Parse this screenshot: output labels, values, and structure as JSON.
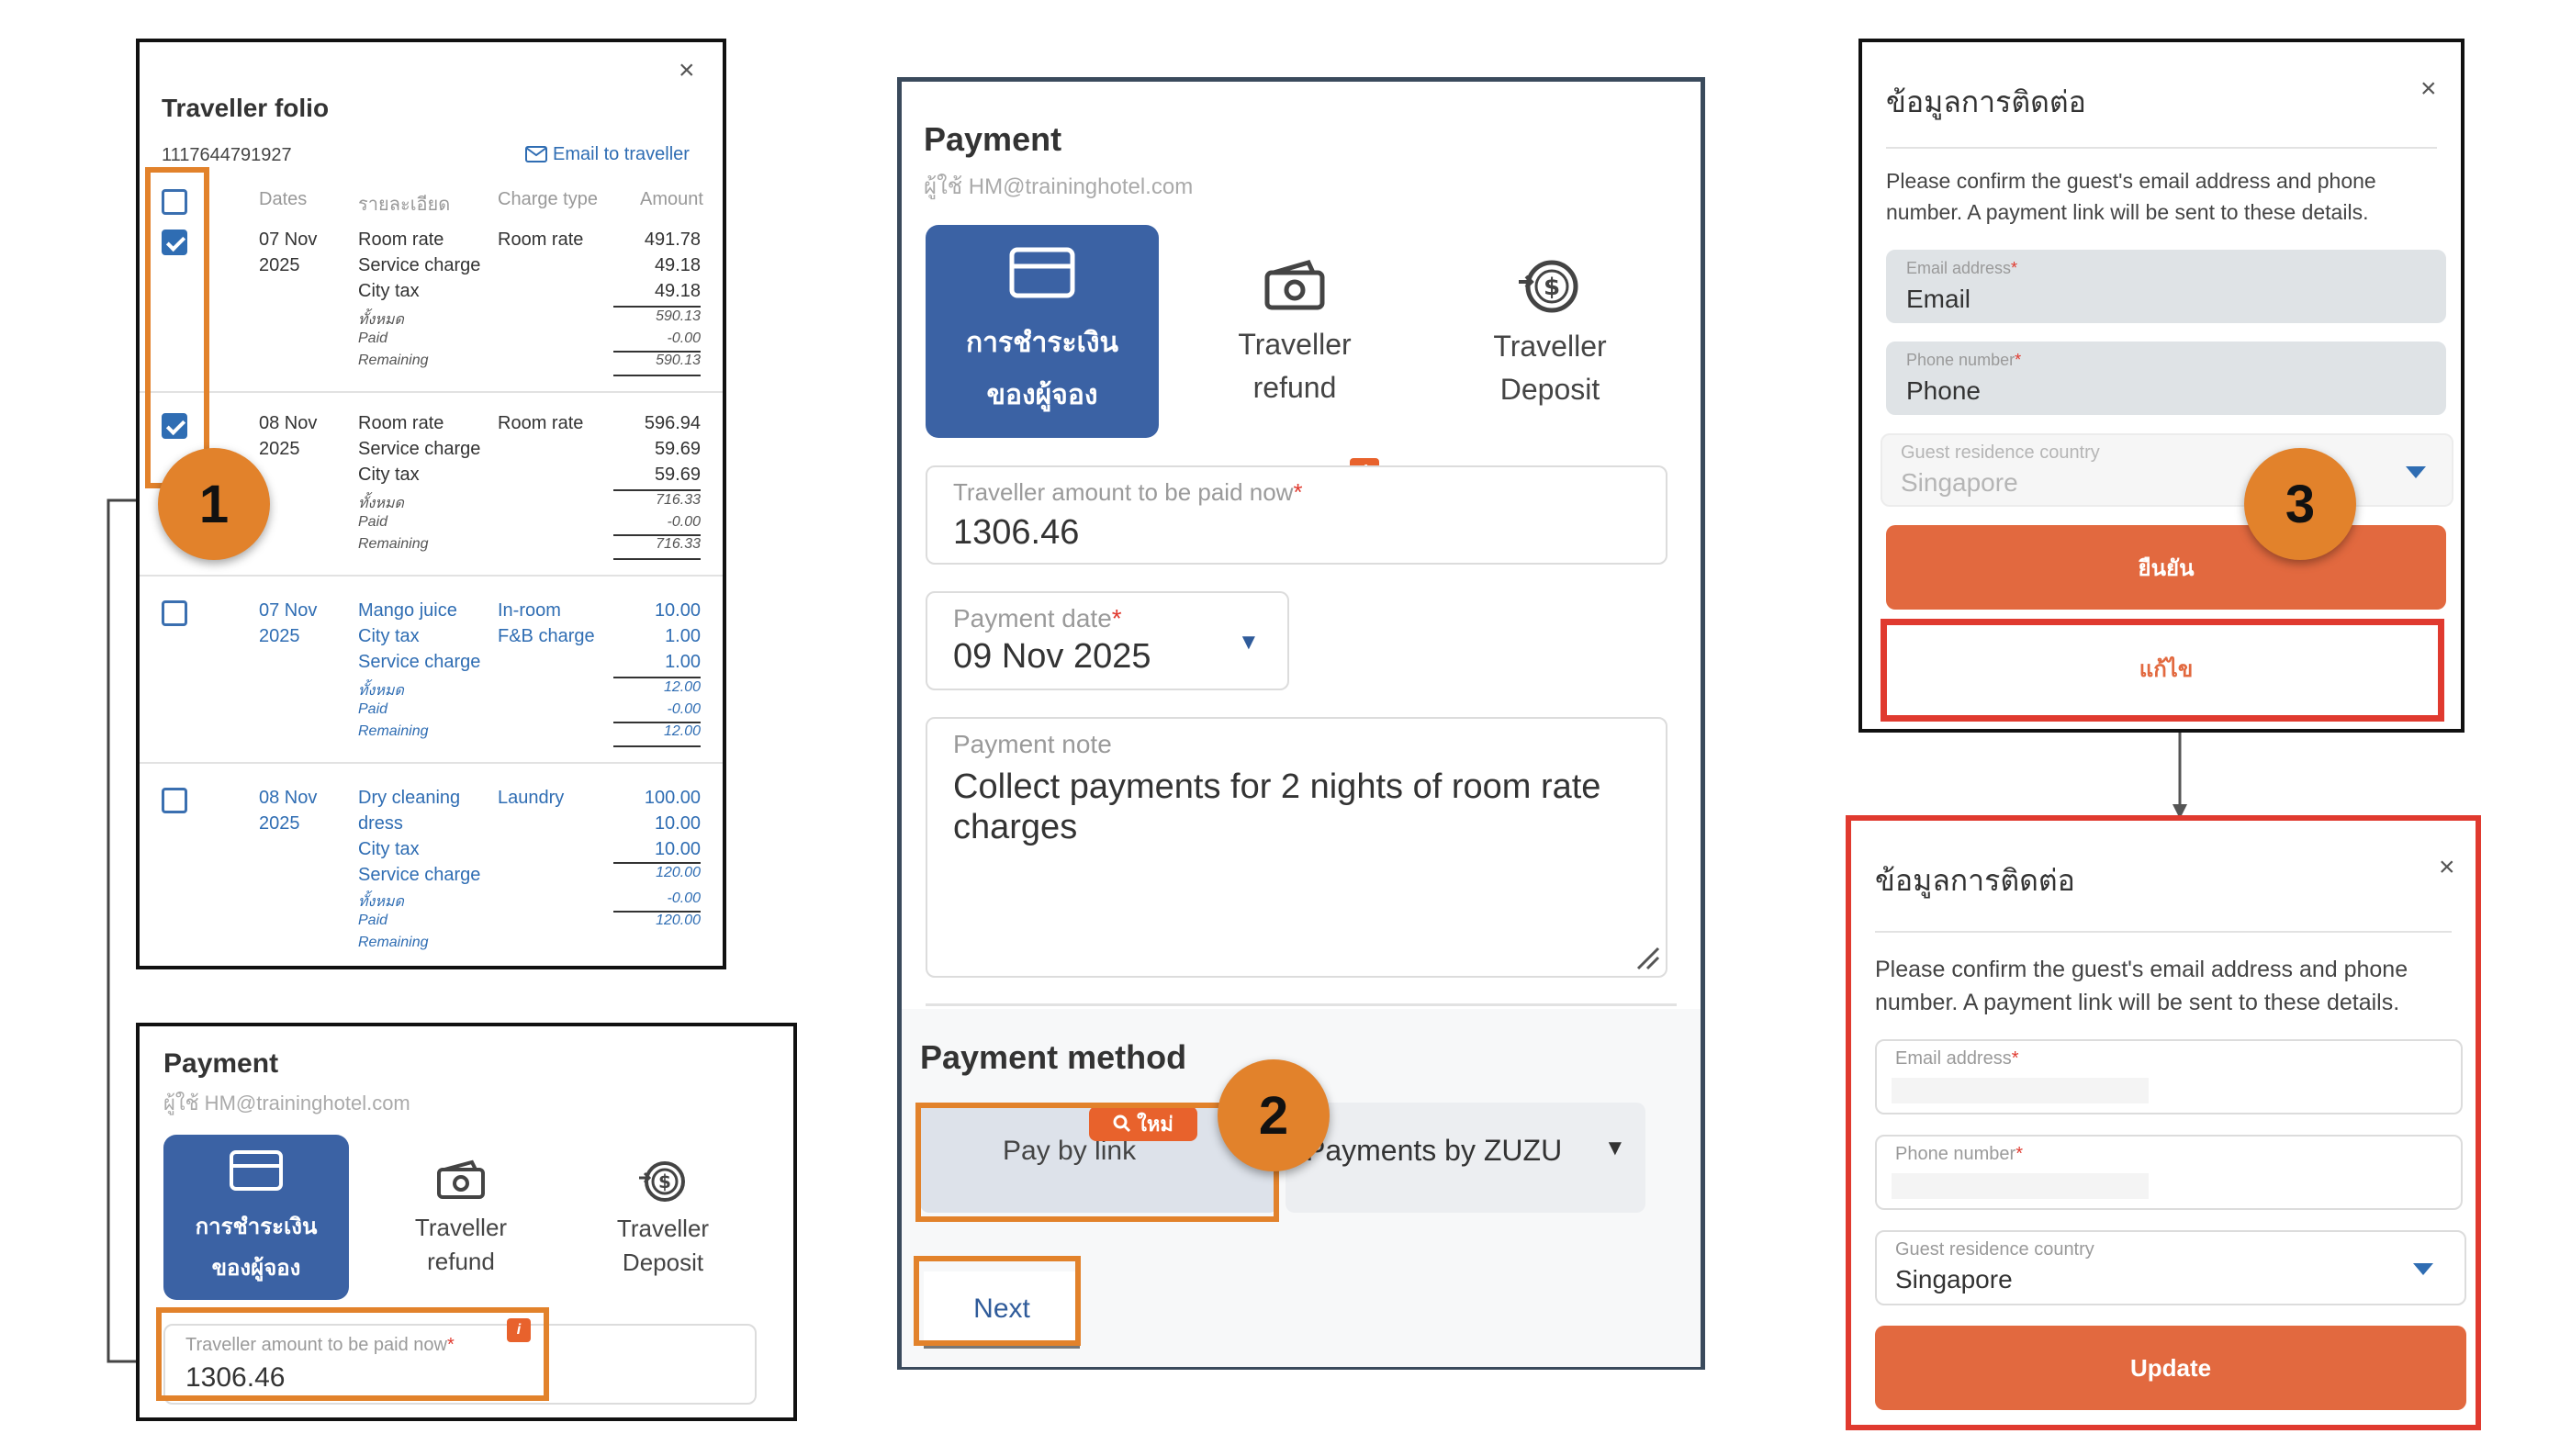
{
  "folio": {
    "title": "Traveller folio",
    "folio_number": "1117644791927",
    "email_link": "Email to traveller",
    "headers": {
      "dates": "Dates",
      "details": "รายละเอียด",
      "charge_type": "Charge type",
      "amount": "Amount"
    },
    "rows": [
      {
        "day": "07 Nov",
        "year": "2025",
        "checked": true,
        "items": [
          "Room rate",
          "Service charge",
          "City tax"
        ],
        "charge_type": "Room rate",
        "amounts": [
          "491.78",
          "49.18",
          "49.18"
        ],
        "total_label": "ทั้งหมด",
        "total": "590.13",
        "paid_label": "Paid",
        "paid": "-0.00",
        "remaining_label": "Remaining",
        "remaining": "590.13"
      },
      {
        "day": "08 Nov",
        "year": "2025",
        "checked": true,
        "items": [
          "Room rate",
          "Service charge",
          "City tax"
        ],
        "charge_type": "Room rate",
        "amounts": [
          "596.94",
          "59.69",
          "59.69"
        ],
        "total_label": "ทั้งหมด",
        "total": "716.33",
        "paid_label": "Paid",
        "paid": "-0.00",
        "remaining_label": "Remaining",
        "remaining": "716.33"
      },
      {
        "day": "07 Nov",
        "year": "2025",
        "checked": false,
        "items": [
          "Mango juice",
          "City tax",
          "Service charge"
        ],
        "charge_type_1": "In-room",
        "charge_type_2": "F&B charge",
        "amounts": [
          "10.00",
          "1.00",
          "1.00"
        ],
        "total_label": "ทั้งหมด",
        "total": "12.00",
        "paid_label": "Paid",
        "paid": "-0.00",
        "remaining_label": "Remaining",
        "remaining": "12.00"
      },
      {
        "day": "08 Nov",
        "year": "2025",
        "checked": false,
        "items": [
          "Dry cleaning",
          "dress",
          "City tax",
          "Service charge"
        ],
        "charge_type": "Laundry",
        "amounts": [
          "100.00",
          "10.00",
          "10.00"
        ],
        "total_label": "ทั้งหมด",
        "total": "120.00",
        "paid_label": "Paid",
        "paid": "-0.00",
        "remaining_label": "Remaining",
        "remaining": "120.00"
      }
    ]
  },
  "payment_small": {
    "title": "Payment",
    "user": "ผู้ใช้ HM@traininghotel.com",
    "tabs": [
      {
        "line1": "การชำระเงิน",
        "line2": "ของผู้จอง",
        "icon": "card-icon"
      },
      {
        "line1": "Traveller",
        "line2": "refund",
        "icon": "cash-icon"
      },
      {
        "line1": "Traveller",
        "line2": "Deposit",
        "icon": "deposit-icon"
      }
    ],
    "amount_label": "Traveller amount to be paid now",
    "amount_required": "*",
    "amount_value": "1306.46",
    "info_badge": "i"
  },
  "payment_main": {
    "title": "Payment",
    "user": "ผู้ใช้ HM@traininghotel.com",
    "tabs": [
      {
        "line1": "การชำระเงิน",
        "line2": "ของผู้จอง",
        "icon": "card-icon"
      },
      {
        "line1": "Traveller",
        "line2": "refund",
        "icon": "cash-icon"
      },
      {
        "line1": "Traveller",
        "line2": "Deposit",
        "icon": "deposit-icon"
      }
    ],
    "info_badge": "i",
    "amount_label": "Traveller amount to be paid now",
    "amount_required": "*",
    "amount_value": "1306.46",
    "date_label": "Payment date",
    "date_required": "*",
    "date_value": "09 Nov 2025",
    "note_label": "Payment note",
    "note_value": "Collect payments for 2 nights of room rate charges",
    "method_title": "Payment method",
    "new_badge": "ใหม่",
    "pay_by_link": "Pay by link",
    "payments_by": "Payments by ZUZU",
    "next": "Next"
  },
  "contact_top": {
    "title": "ข้อมูลการติดต่อ",
    "description": "Please confirm the guest's email address and phone number. A payment link will be sent to these details.",
    "email_label": "Email address",
    "email_value": "Email",
    "phone_label": "Phone number",
    "phone_value": "Phone",
    "country_label": "Guest residence country",
    "country_value": "Singapore",
    "required": "*",
    "confirm": "ยืนยัน",
    "edit": "แก้ไข"
  },
  "contact_bottom": {
    "title": "ข้อมูลการติดต่อ",
    "description": "Please confirm the guest's email address and phone number. A payment link will be sent to these details.",
    "email_label": "Email address",
    "phone_label": "Phone number",
    "country_label": "Guest residence country",
    "country_value": "Singapore",
    "required": "*",
    "update": "Update"
  },
  "callouts": {
    "one": "1",
    "two": "2",
    "three": "3"
  },
  "colors": {
    "accent_orange": "#e2822b",
    "button_orange": "#e2693f",
    "highlight_red": "#e03a2f",
    "active_tab": "#3b62a4",
    "link_blue": "#2f6db3"
  }
}
